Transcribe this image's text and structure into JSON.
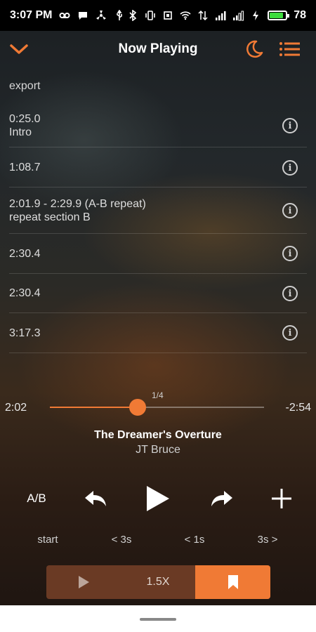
{
  "status": {
    "time": "3:07 PM",
    "battery": "78"
  },
  "header": {
    "title": "Now Playing"
  },
  "list": {
    "export_label": "export",
    "bookmarks": [
      {
        "time": "0:25.0",
        "label": "Intro"
      },
      {
        "time": "1:08.7",
        "label": ""
      },
      {
        "time": "2:01.9 - 2:29.9 (A-B repeat)",
        "label": "repeat section B"
      },
      {
        "time": "2:30.4",
        "label": ""
      },
      {
        "time": "2:30.4",
        "label": ""
      },
      {
        "time": "3:17.3",
        "label": ""
      }
    ]
  },
  "player": {
    "elapsed": "2:02",
    "remaining": "-2:54",
    "counter": "1/4",
    "progress_fraction": 0.41,
    "song_title": "The Dreamer's Overture",
    "artist": "JT Bruce"
  },
  "controls": {
    "ab_label": "A/B",
    "start_label": "start",
    "back_label": "< 3s",
    "fwd1_label": "< 1s",
    "fwd3_label": "3s >"
  },
  "bottom": {
    "speed_label": "1.5X"
  },
  "colors": {
    "accent": "#f07a35"
  }
}
